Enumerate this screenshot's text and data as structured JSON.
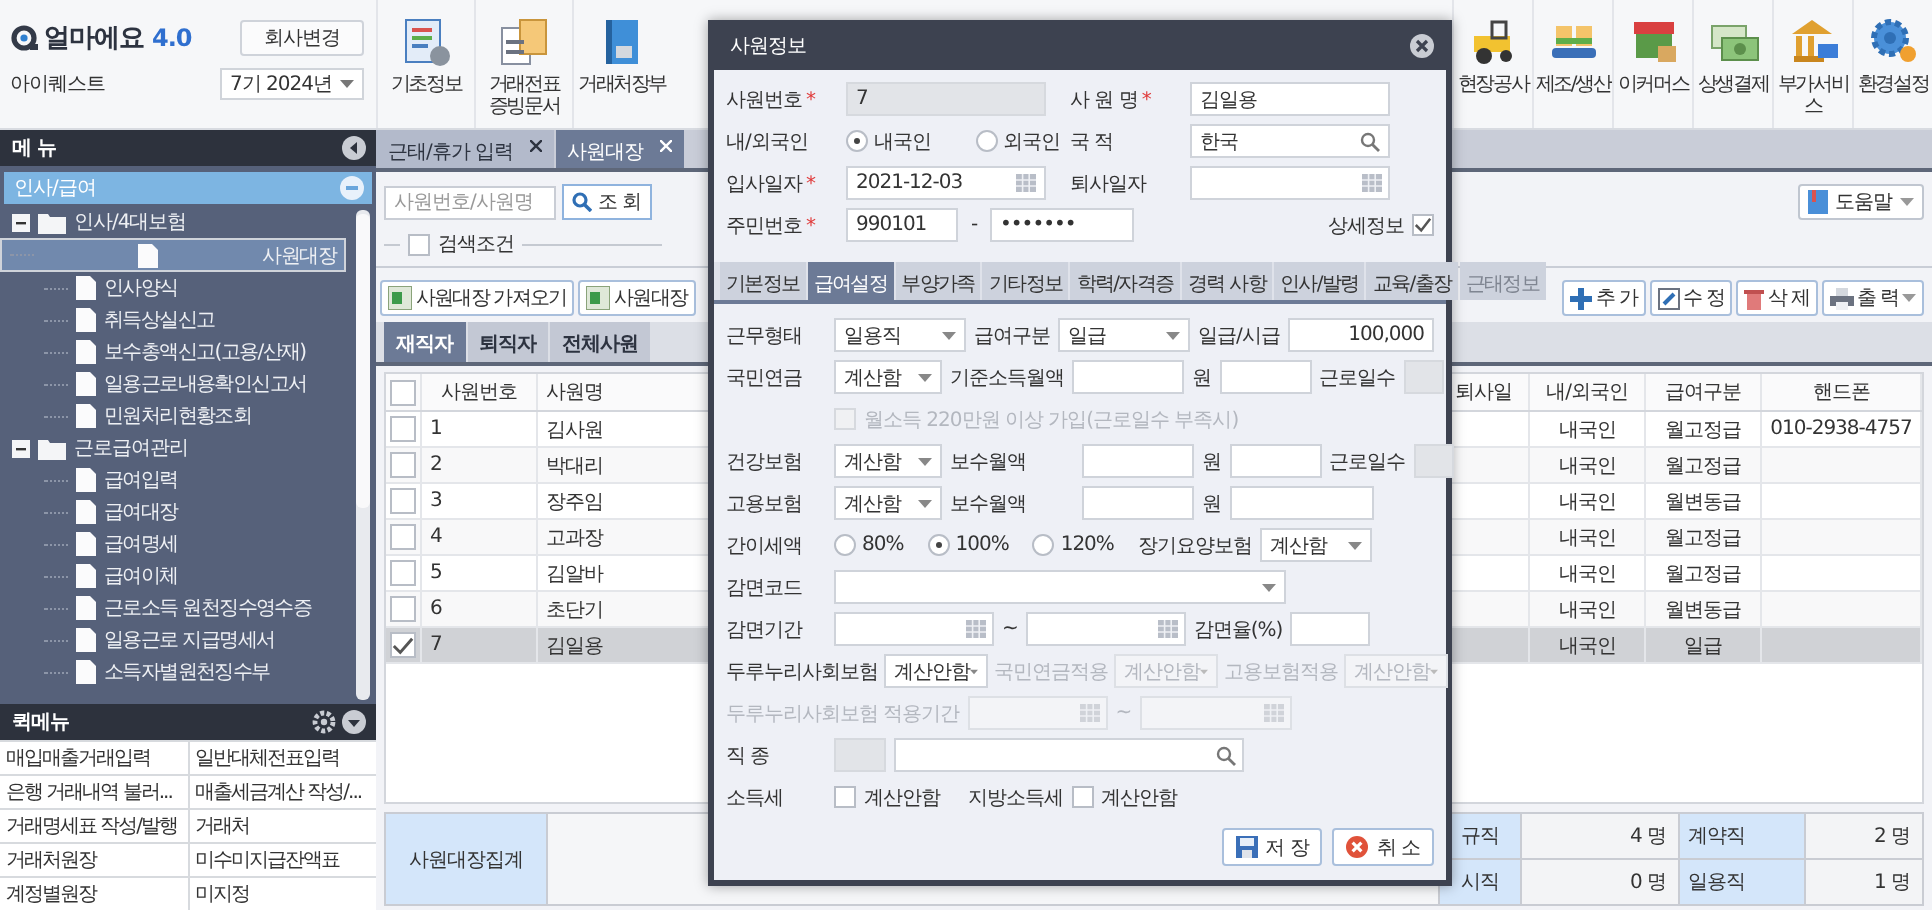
{
  "header": {
    "logo": "얼마에요",
    "version": "4.0",
    "company_button": "회사변경",
    "company": "아이퀘스트",
    "period": "7기 2024년"
  },
  "toolbar_left": [
    {
      "label": "기초정보"
    },
    {
      "label": "거래전표 증빙문서"
    },
    {
      "label": "거래처장부"
    }
  ],
  "toolbar_right": [
    {
      "label": "현장공사"
    },
    {
      "label": "제조/생산"
    },
    {
      "label": "이커머스"
    },
    {
      "label": "상생결제"
    },
    {
      "label": "부가서비스"
    },
    {
      "label": "환경설정"
    }
  ],
  "menu": {
    "title": "메 뉴",
    "section": "인사/급여",
    "tree": [
      {
        "label": "인사/4대보험",
        "expanded": true,
        "children": [
          {
            "label": "사원대장",
            "selected": true
          },
          {
            "label": "인사양식",
            "selected": false
          },
          {
            "label": "취득상실신고",
            "selected": false
          },
          {
            "label": "보수총액신고(고용/산재)",
            "selected": false
          },
          {
            "label": "일용근로내용확인신고서",
            "selected": false
          },
          {
            "label": "민원처리현황조회",
            "selected": false
          }
        ]
      },
      {
        "label": "근로급여관리",
        "expanded": true,
        "children": [
          {
            "label": "급여입력",
            "selected": false
          },
          {
            "label": "급여대장",
            "selected": false
          },
          {
            "label": "급여명세",
            "selected": false
          },
          {
            "label": "급여이체",
            "selected": false
          },
          {
            "label": "근로소득 원천징수영수증",
            "selected": false
          },
          {
            "label": "일용근로 지급명세서",
            "selected": false
          },
          {
            "label": "소득자별원천징수부",
            "selected": false
          }
        ]
      }
    ]
  },
  "quick_menu": {
    "title": "퀵메뉴",
    "items": [
      "매입매출거래입력",
      "일반대체전표입력",
      "은행 거래내역 불러...",
      "매출세금계산 작성/...",
      "거래명세표 작성/발행",
      "거래처",
      "거래처원장",
      "미수미지급잔액표",
      "계정별원장",
      "미지정"
    ]
  },
  "page_tabs": [
    {
      "label": "근태/휴가 입력",
      "selected": false
    },
    {
      "label": "사원대장",
      "selected": true
    }
  ],
  "search": {
    "placeholder": "사원번호/사원명",
    "button": "조 회",
    "condition": {
      "label": "검색조건",
      "checked": false
    },
    "help": "도움말"
  },
  "actions_left": [
    "사원대장 가져오기",
    "사원대장"
  ],
  "actions_right": [
    "추 가",
    "수 정",
    "삭 제",
    "출 력"
  ],
  "list_tabs": [
    {
      "label": "재직자",
      "selected": true
    },
    {
      "label": "퇴직자",
      "selected": false
    },
    {
      "label": "전체사원",
      "selected": false
    }
  ],
  "table": {
    "select_all": false,
    "columns": [
      "사원번호",
      "사원명",
      "퇴사일",
      "내/외국인",
      "급여구분",
      "핸드폰"
    ],
    "rows": [
      {
        "checked": false,
        "selected": false,
        "no": "1",
        "name": "김사원",
        "nationality": "내국인",
        "pay_type": "월고정급",
        "phone": "010-2938-4757"
      },
      {
        "checked": false,
        "selected": false,
        "no": "2",
        "name": "박대리",
        "nationality": "내국인",
        "pay_type": "월고정급"
      },
      {
        "checked": false,
        "selected": false,
        "no": "3",
        "name": "장주임",
        "nationality": "내국인",
        "pay_type": "월변동급"
      },
      {
        "checked": false,
        "selected": false,
        "no": "4",
        "name": "고과장",
        "nationality": "내국인",
        "pay_type": "월고정급"
      },
      {
        "checked": false,
        "selected": false,
        "no": "5",
        "name": "김알바",
        "nationality": "내국인",
        "pay_type": "월고정급"
      },
      {
        "checked": false,
        "selected": false,
        "no": "6",
        "name": "초단기",
        "nationality": "내국인",
        "pay_type": "월변동급"
      },
      {
        "checked": true,
        "selected": true,
        "no": "7",
        "name": "김일용",
        "nationality": "내국인",
        "pay_type": "일급"
      }
    ]
  },
  "summary": {
    "title": "사원대장집계",
    "cells": [
      {
        "label": "규직",
        "value": "4 명"
      },
      {
        "label": "계약직",
        "value": "2 명"
      },
      {
        "label": "시직",
        "value": "0 명"
      },
      {
        "label": "일용직",
        "value": "1 명"
      }
    ]
  },
  "dialog": {
    "title": "사원정보",
    "required_mark": "*",
    "emp_no": {
      "label": "사원번호",
      "required": true,
      "value": "7"
    },
    "name": {
      "label": "사 원 명",
      "required": true,
      "value": "김일용"
    },
    "nationality": {
      "label": "내/외국인",
      "options": [
        {
          "label": "내국인",
          "selected": true
        },
        {
          "label": "외국인",
          "selected": false
        }
      ]
    },
    "country": {
      "label": "국 적",
      "value": "한국"
    },
    "hire_date": {
      "label": "입사일자",
      "required": true,
      "value": "2021-12-03"
    },
    "leave_date": {
      "label": "퇴사일자"
    },
    "rrn": {
      "label": "주민번호",
      "required": true,
      "first": "990101",
      "separator": "-",
      "second": "•••••••"
    },
    "detail": {
      "label": "상세정보",
      "checked": true
    },
    "tabs": [
      {
        "label": "기본정보",
        "selected": false,
        "disabled": false
      },
      {
        "label": "급여설정",
        "selected": true,
        "disabled": false
      },
      {
        "label": "부양가족",
        "selected": false,
        "disabled": false
      },
      {
        "label": "기타정보",
        "selected": false,
        "disabled": false
      },
      {
        "label": "학력/자격증",
        "selected": false,
        "disabled": false
      },
      {
        "label": "경력 사항",
        "selected": false,
        "disabled": false
      },
      {
        "label": "인사/발령",
        "selected": false,
        "disabled": false
      },
      {
        "label": "교육/출장",
        "selected": false,
        "disabled": false
      },
      {
        "label": "근태정보",
        "selected": false,
        "disabled": true
      }
    ],
    "pay": {
      "work_type": {
        "label": "근무형태",
        "value": "일용직"
      },
      "pay_type": {
        "label": "급여구분",
        "value": "일급"
      },
      "wage": {
        "label": "일급/시급",
        "value": "100,000"
      },
      "pension": {
        "label": "국민연금",
        "value": "계산함",
        "base_label": "기준소득월액",
        "unit": "원",
        "days_label": "근로일수"
      },
      "pension_extra": {
        "label": "월소득 220만원 이상 가입(근로일수 부족시)",
        "checked": false,
        "disabled": true
      },
      "health": {
        "label": "건강보험",
        "value": "계산함",
        "base_label": "보수월액",
        "unit": "원",
        "days_label": "근로일수"
      },
      "employment": {
        "label": "고용보험",
        "value": "계산함",
        "base_label": "보수월액",
        "unit": "원"
      },
      "tax_rate": {
        "label": "간이세액",
        "options": [
          {
            "label": "80%",
            "selected": false
          },
          {
            "label": "100%",
            "selected": true
          },
          {
            "label": "120%",
            "selected": false
          }
        ]
      },
      "ltc": {
        "label": "장기요양보험",
        "value": "계산함"
      },
      "reduction_code": {
        "label": "감면코드"
      },
      "reduction_period": {
        "label": "감면기간",
        "separator": "~"
      },
      "reduction_rate": {
        "label": "감면율(%)"
      },
      "durunuri": {
        "label": "두루누리사회보험",
        "value": "계산안함",
        "pension_label": "국민연금적용",
        "pension_value": "계산안함",
        "employment_label": "고용보험적용",
        "employment_value": "계산안함",
        "sub_disabled": true
      },
      "durunuri_period": {
        "label": "두루누리사회보험 적용기간",
        "separator": "~",
        "disabled": true
      },
      "job": {
        "label": "직 종"
      },
      "income_tax": {
        "label": "소득세",
        "option": "계산안함",
        "checked": false
      },
      "local_tax": {
        "label": "지방소득세",
        "option": "계산안함",
        "checked": false
      }
    },
    "buttons": [
      "저 장",
      "취 소"
    ]
  }
}
